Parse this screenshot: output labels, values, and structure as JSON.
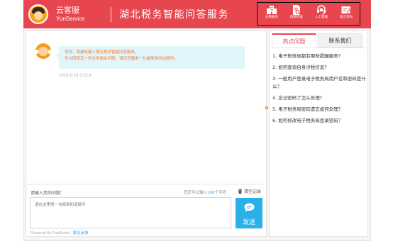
{
  "header": {
    "brand_cn": "云客服",
    "brand_en": "YunService",
    "title": "湖北税务智能问答服务",
    "tools": [
      {
        "label": "办税服务",
        "icon": "building-icon"
      },
      {
        "label": "政策检索",
        "icon": "document-search-icon"
      },
      {
        "label": "人工客服",
        "icon": "headset-icon"
      },
      {
        "label": "留言咨询",
        "icon": "message-edit-icon"
      }
    ]
  },
  "chat": {
    "bot_message_line1": "您好，我是机器人湖北税务智能问答服务。",
    "bot_message_line2": "可以回答您一些业务相关问题，请您尽量用一句最简单的话提问。",
    "bot_message_time": "2019-6-18 9:23:4"
  },
  "input": {
    "label": "请输入您的问题：",
    "char_tip_prefix": "您还可以输入",
    "char_count": "100",
    "char_tip_suffix": "个字符",
    "clear_label": "清空记录",
    "placeholder": "请在这里用一句简单的话提问",
    "send_label": "发送",
    "powered_by": "Powered By FaqRobot",
    "feedback_link": "意见反馈"
  },
  "sidebar": {
    "tabs": [
      {
        "label": "热点问题",
        "active": true
      },
      {
        "label": "联系我们",
        "active": false
      }
    ],
    "hot_questions": [
      "1. 电子税务局都有哪些提醒服务？",
      "2. 如何查询自身涉税信息？",
      "3. 一般用户登录电子税务局用户名和密码是什么？",
      "4. 忘记密码了怎么处理？",
      "5. 电子税务局密码遗忘如何处理？",
      "6. 如何修改电子税务局登录密码？"
    ]
  },
  "colors": {
    "brand_red": "#e8464f",
    "send_blue": "#2ab1ea",
    "bubble_bg": "#e2f5fb",
    "bubble_text": "#f07a2e"
  }
}
